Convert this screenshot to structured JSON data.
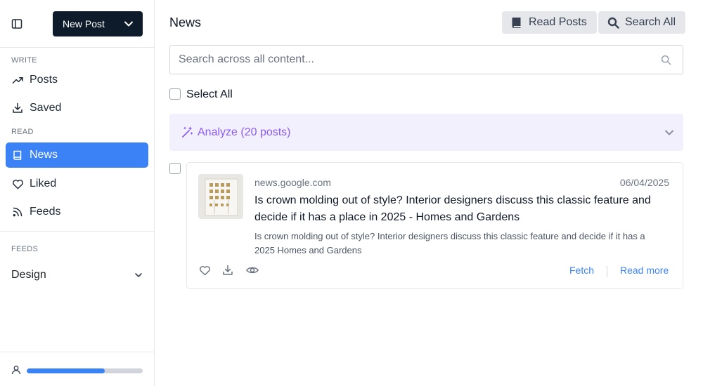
{
  "sidebar": {
    "new_post_label": "New Post",
    "write_label": "WRITE",
    "write_items": [
      {
        "label": "Posts",
        "icon": "trending-up-icon"
      },
      {
        "label": "Saved",
        "icon": "download-icon"
      }
    ],
    "read_label": "READ",
    "read_items": [
      {
        "label": "News",
        "icon": "book-icon",
        "active": true
      },
      {
        "label": "Liked",
        "icon": "heart-icon"
      },
      {
        "label": "Feeds",
        "icon": "rss-icon"
      }
    ],
    "feeds_label": "FEEDS",
    "feed_group": "Design",
    "progress": 0.67
  },
  "header": {
    "title": "News",
    "read_posts_label": "Read Posts",
    "search_all_label": "Search All"
  },
  "search": {
    "placeholder": "Search across all content...",
    "value": ""
  },
  "select_all_label": "Select All",
  "analyze_label": "Analyze (20 posts)",
  "posts": [
    {
      "source": "news.google.com",
      "date": "06/04/2025",
      "title": "Is crown molding out of style? Interior designers discuss this classic feature and decide if it has a place in 2025 - Homes and Gardens",
      "summary": "Is crown molding out of style? Interior designers discuss this classic feature and decide if it has a 2025  Homes and Gardens",
      "fetch_label": "Fetch",
      "read_more_label": "Read more"
    }
  ],
  "colors": {
    "accent": "#3b82f6",
    "dark": "#0d1b2a",
    "analyze_bg": "#f3f0fd",
    "analyze_text": "#8b5cf6"
  }
}
